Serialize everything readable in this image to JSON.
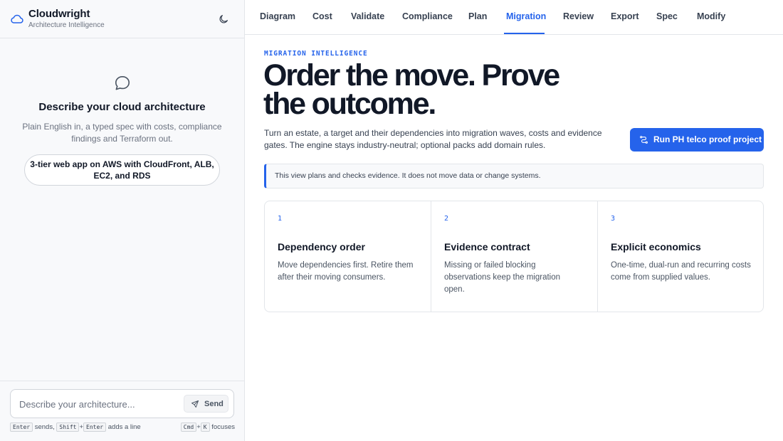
{
  "brand": {
    "name": "Cloudwright",
    "tagline": "Architecture Intelligence",
    "logo_icon": "cloud-icon",
    "theme_icon": "moon-icon"
  },
  "sidebar": {
    "empty_state": {
      "icon": "chat-bubble-icon",
      "title": "Describe your cloud architecture",
      "description": "Plain English in, a typed spec with costs, compliance findings and Terraform out.",
      "suggestion": "3-tier web app on AWS with CloudFront, ALB, EC2, and RDS"
    },
    "composer": {
      "placeholder": "Describe your architecture...",
      "send_label": "Send",
      "send_icon": "paper-plane-icon",
      "hint_enter_key": "Enter",
      "hint_enter_text": "sends,",
      "hint_shift_key": "Shift",
      "hint_plus": "+",
      "hint_enter_key_2": "Enter",
      "hint_newline_text": "adds a line",
      "hint_cmd_key": "Cmd",
      "hint_k_key": "K",
      "hint_focus_text": "focuses"
    }
  },
  "tabs": [
    {
      "label": "Diagram",
      "active": false
    },
    {
      "label": "Cost",
      "active": false
    },
    {
      "label": "Validate",
      "active": false
    },
    {
      "label": "Compliance",
      "active": false
    },
    {
      "label": "Plan",
      "active": false
    },
    {
      "label": "Migration",
      "active": true
    },
    {
      "label": "Review",
      "active": false
    },
    {
      "label": "Export",
      "active": false
    },
    {
      "label": "Spec",
      "active": false
    },
    {
      "label": "Modify",
      "active": false
    }
  ],
  "migration": {
    "eyebrow": "MIGRATION INTELLIGENCE",
    "headline": "Order the move. Prove the outcome.",
    "intro": "Turn an estate, a target and their dependencies into migration waves, costs and evidence gates. The engine stays industry-neutral; optional packs add domain rules.",
    "run_button_label": "Run PH telco proof project",
    "run_button_icon": "route-icon",
    "notice": "This view plans and checks evidence. It does not move data or change systems.",
    "cards": [
      {
        "number": "1",
        "title": "Dependency order",
        "body": "Move dependencies first. Retire them after their moving consumers."
      },
      {
        "number": "2",
        "title": "Evidence contract",
        "body": "Missing or failed blocking observations keep the migration open."
      },
      {
        "number": "3",
        "title": "Explicit economics",
        "body": "One-time, dual-run and recurring costs come from supplied values."
      }
    ]
  },
  "colors": {
    "accent": "#2563eb",
    "sidebar_bg": "#f8f9fb",
    "border": "#e3e6ea",
    "text": "#111827",
    "muted": "#6b7280"
  }
}
